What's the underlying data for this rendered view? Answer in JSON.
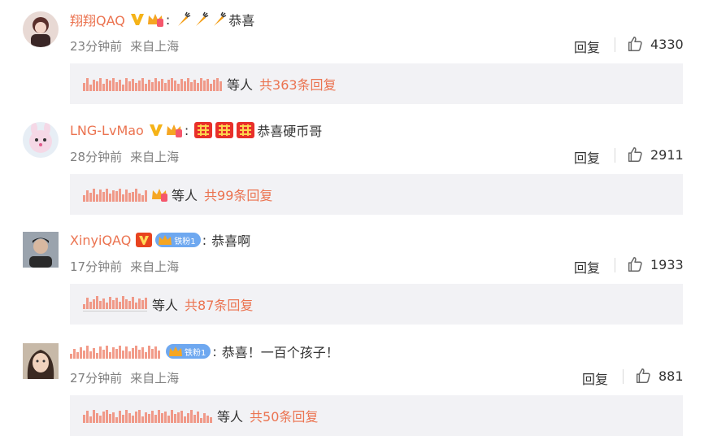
{
  "colors": {
    "accent": "#eb7350",
    "meta": "#808080",
    "reply_bg": "#f2f2f5",
    "fan_badge": "#6ea8f0"
  },
  "comments": [
    {
      "username": "翔翔QAQ",
      "content": "恭喜",
      "emojis": [
        "carrot-icon",
        "carrot-icon",
        "carrot-icon"
      ],
      "time": "23分钟前",
      "location": "来自上海",
      "reply_label": "回复",
      "likes": "4330",
      "reply_etc": "等人",
      "reply_total": "共363条回复"
    },
    {
      "username": "LNG-LvMao",
      "content": "恭喜硬币哥",
      "emojis": [
        "double-happiness-icon",
        "double-happiness-icon",
        "double-happiness-icon"
      ],
      "time": "28分钟前",
      "location": "来自上海",
      "reply_label": "回复",
      "likes": "2911",
      "reply_etc": "等人",
      "reply_total": "共99条回复"
    },
    {
      "username": "XinyiQAQ",
      "fan_badge": "铁粉1",
      "content": "恭喜啊",
      "time": "17分钟前",
      "location": "来自上海",
      "reply_label": "回复",
      "likes": "1933",
      "reply_etc": "等人",
      "reply_total": "共87条回复"
    },
    {
      "username": "",
      "fan_badge": "铁粉1",
      "content": "恭喜！一百个孩子！",
      "time": "27分钟前",
      "location": "来自上海",
      "reply_label": "回复",
      "likes": "881",
      "reply_etc": "等人",
      "reply_total": "共50条回复"
    }
  ]
}
